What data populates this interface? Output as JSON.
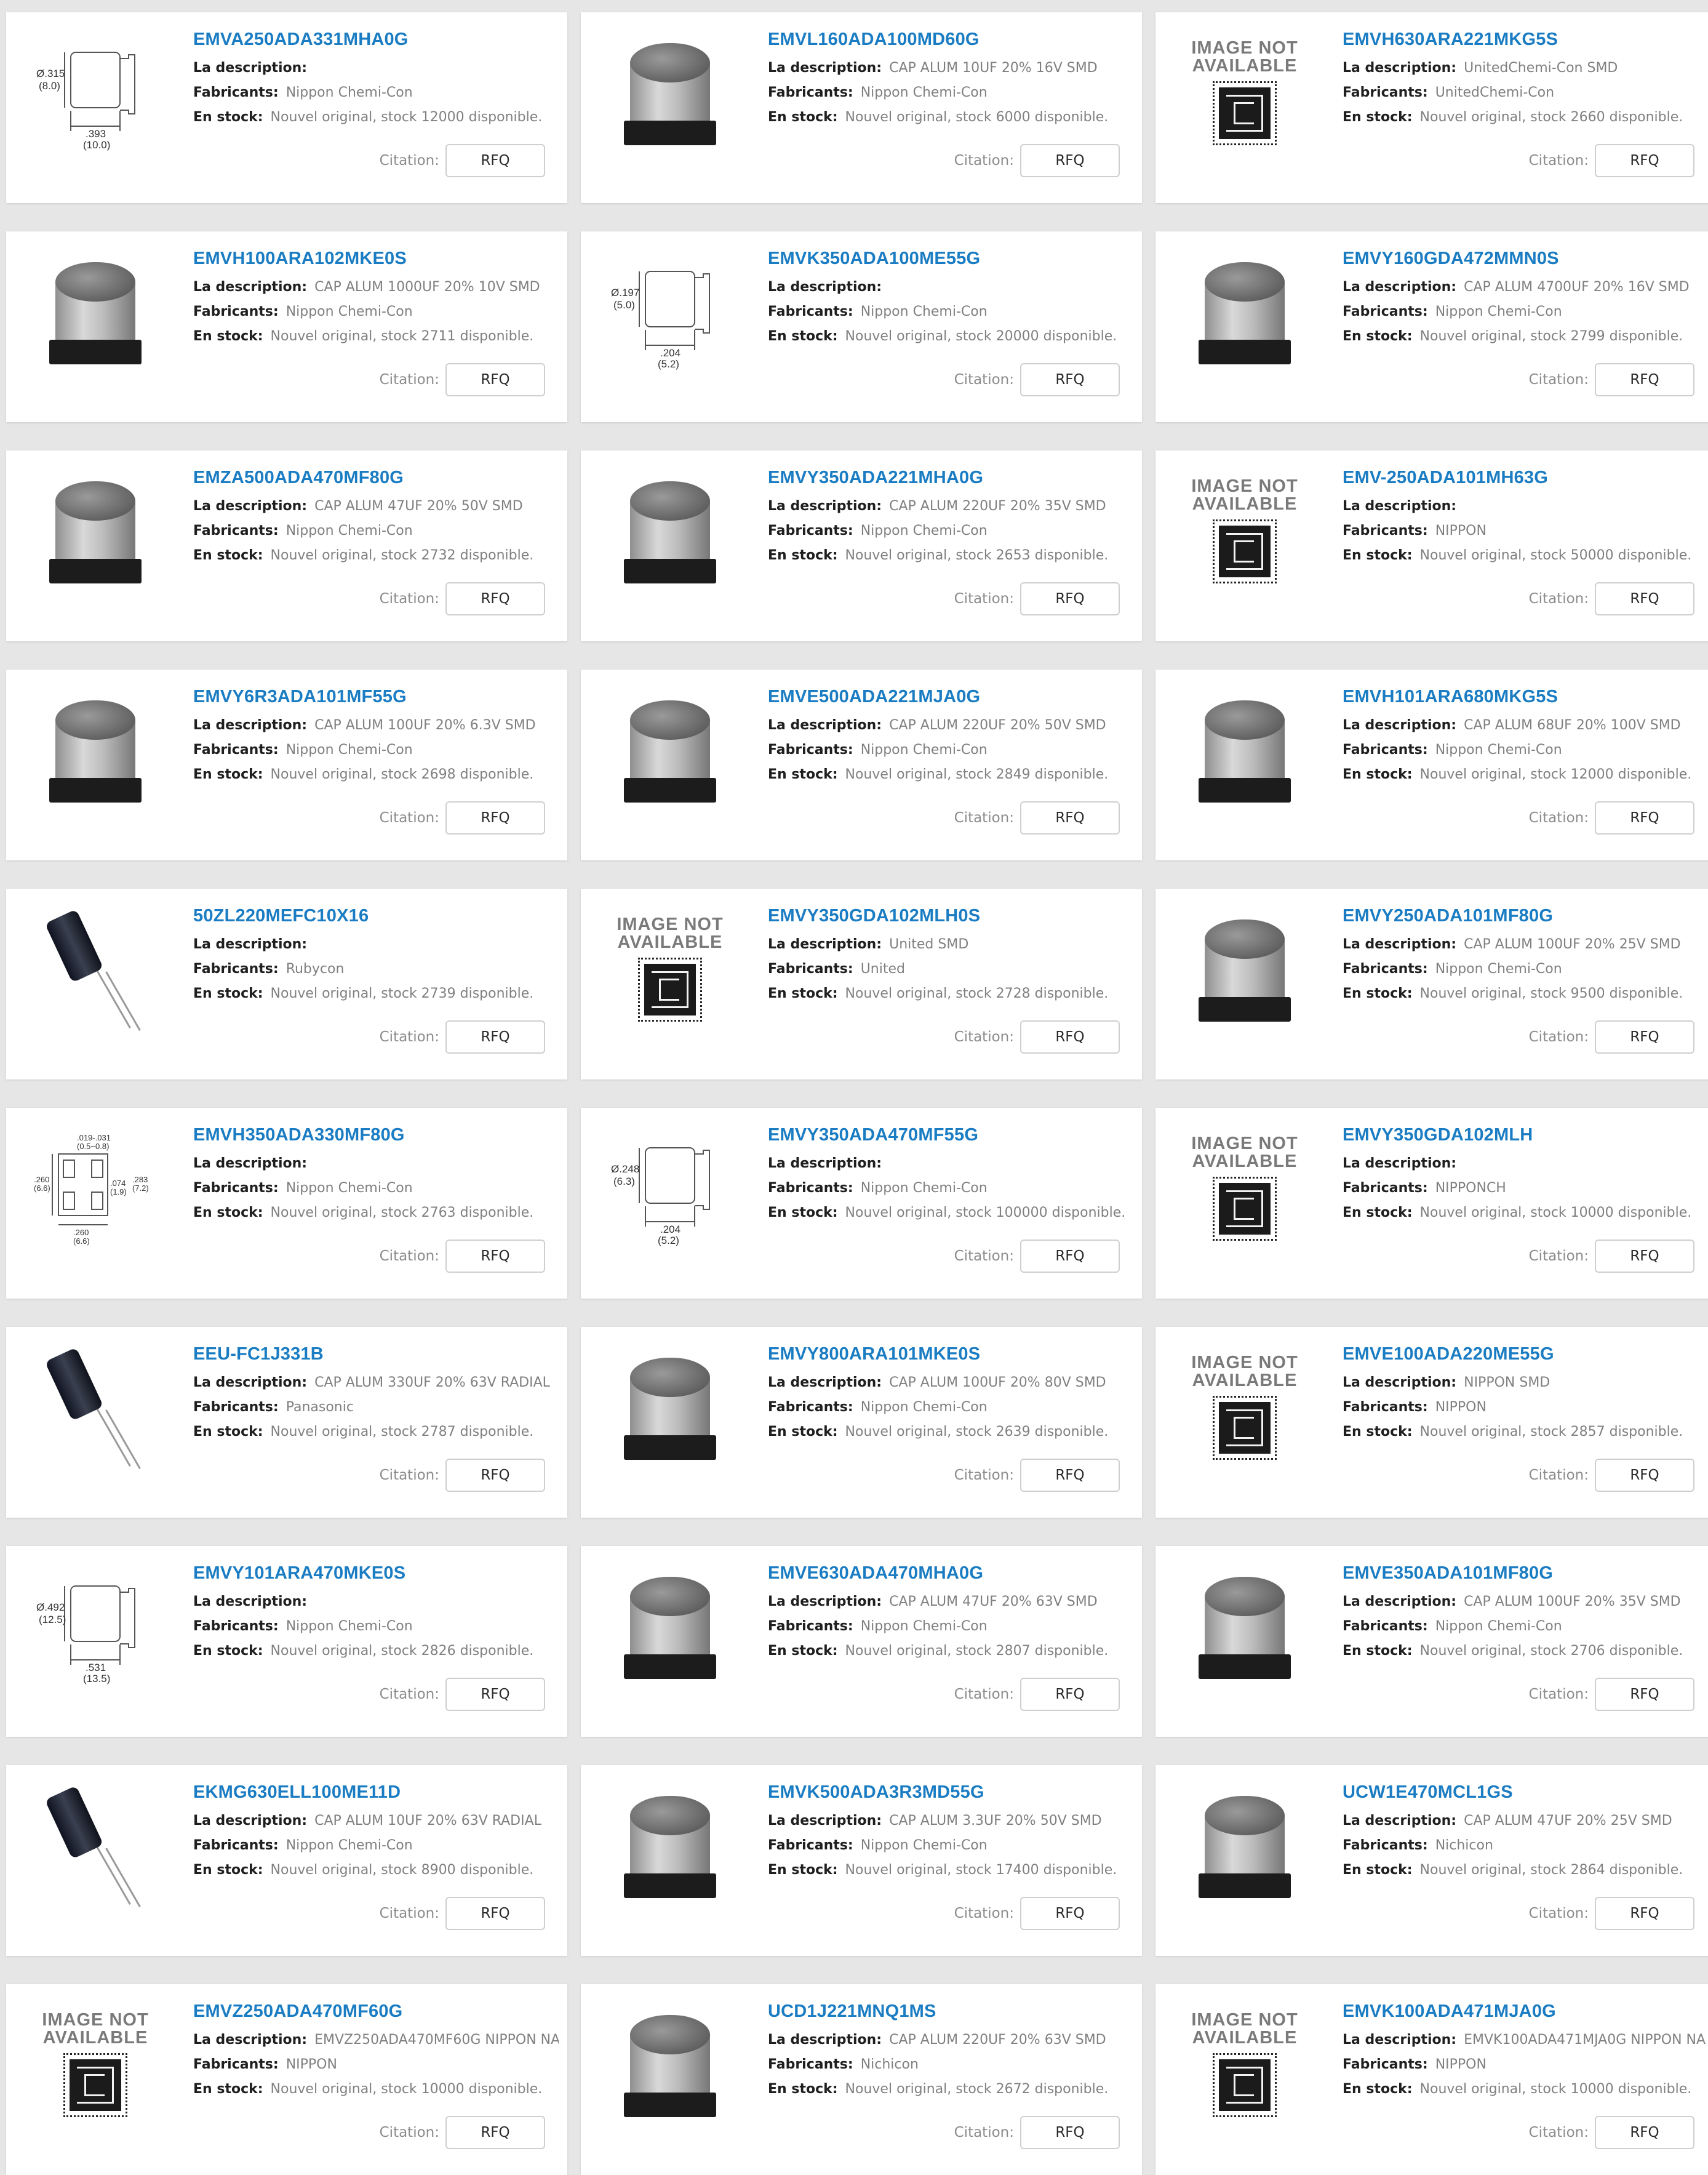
{
  "labels": {
    "description": "La description:",
    "manufacturer": "Fabricants:",
    "stock": "En stock:",
    "quote": "Citation:",
    "rfq": "RFQ",
    "image_not_available": [
      "IMAGE NOT",
      "AVAILABLE"
    ]
  },
  "products": [
    {
      "part": "EMVA250ADA331MHA0G",
      "description": "",
      "manufacturer": "Nippon Chemi-Con",
      "stock": "Nouvel original, stock 12000 disponible.",
      "image": "drawing",
      "dim": [
        "Ø.315",
        "(8.0)",
        ".393",
        "(10.0)"
      ]
    },
    {
      "part": "EMVL160ADA100MD60G",
      "description": "CAP ALUM 10UF 20% 16V SMD",
      "manufacturer": "Nippon Chemi-Con",
      "stock": "Nouvel original, stock 6000 disponible.",
      "image": "smd"
    },
    {
      "part": "EMVH630ARA221MKG5S",
      "description": "UnitedChemi-Con SMD",
      "manufacturer": "UnitedChemi-Con",
      "stock": "Nouvel original, stock 2660 disponible.",
      "image": "na"
    },
    {
      "part": "EMVH100ARA102MKE0S",
      "description": "CAP ALUM 1000UF 20% 10V SMD",
      "manufacturer": "Nippon Chemi-Con",
      "stock": "Nouvel original, stock 2711 disponible.",
      "image": "smd"
    },
    {
      "part": "EMVK350ADA100ME55G",
      "description": "",
      "manufacturer": "Nippon Chemi-Con",
      "stock": "Nouvel original, stock 20000 disponible.",
      "image": "drawing",
      "dim": [
        "Ø.197",
        "(5.0)",
        ".204",
        "(5.2)"
      ]
    },
    {
      "part": "EMVY160GDA472MMN0S",
      "description": "CAP ALUM 4700UF 20% 16V SMD",
      "manufacturer": "Nippon Chemi-Con",
      "stock": "Nouvel original, stock 2799 disponible.",
      "image": "smd"
    },
    {
      "part": "EMZA500ADA470MF80G",
      "description": "CAP ALUM 47UF 20% 50V SMD",
      "manufacturer": "Nippon Chemi-Con",
      "stock": "Nouvel original, stock 2732 disponible.",
      "image": "smd"
    },
    {
      "part": "EMVY350ADA221MHA0G",
      "description": "CAP ALUM 220UF 20% 35V SMD",
      "manufacturer": "Nippon Chemi-Con",
      "stock": "Nouvel original, stock 2653 disponible.",
      "image": "smd"
    },
    {
      "part": "EMV-250ADA101MH63G",
      "description": "",
      "manufacturer": "NIPPON",
      "stock": "Nouvel original, stock 50000 disponible.",
      "image": "na"
    },
    {
      "part": "EMVY6R3ADA101MF55G",
      "description": "CAP ALUM 100UF 20% 6.3V SMD",
      "manufacturer": "Nippon Chemi-Con",
      "stock": "Nouvel original, stock 2698 disponible.",
      "image": "smd"
    },
    {
      "part": "EMVE500ADA221MJA0G",
      "description": "CAP ALUM 220UF 20% 50V SMD",
      "manufacturer": "Nippon Chemi-Con",
      "stock": "Nouvel original, stock 2849 disponible.",
      "image": "smd"
    },
    {
      "part": "EMVH101ARA680MKG5S",
      "description": "CAP ALUM 68UF 20% 100V SMD",
      "manufacturer": "Nippon Chemi-Con",
      "stock": "Nouvel original, stock 12000 disponible.",
      "image": "smd"
    },
    {
      "part": "50ZL220MEFC10X16",
      "description": "",
      "manufacturer": "Rubycon",
      "stock": "Nouvel original, stock 2739 disponible.",
      "image": "radial"
    },
    {
      "part": "EMVY350GDA102MLH0S",
      "description": "United SMD",
      "manufacturer": "United",
      "stock": "Nouvel original, stock 2728 disponible.",
      "image": "na"
    },
    {
      "part": "EMVY250ADA101MF80G",
      "description": "CAP ALUM 100UF 20% 25V SMD",
      "manufacturer": "Nippon Chemi-Con",
      "stock": "Nouvel original, stock 9500 disponible.",
      "image": "smd"
    },
    {
      "part": "EMVH350ADA330MF80G",
      "description": "",
      "manufacturer": "Nippon Chemi-Con",
      "stock": "Nouvel original, stock 2763 disponible.",
      "image": "footprint"
    },
    {
      "part": "EMVY350ADA470MF55G",
      "description": "",
      "manufacturer": "Nippon Chemi-Con",
      "stock": "Nouvel original, stock 100000 disponible.",
      "image": "drawing",
      "dim": [
        "Ø.248",
        "(6.3)",
        ".204",
        "(5.2)"
      ]
    },
    {
      "part": "EMVY350GDA102MLH",
      "description": "",
      "manufacturer": "NIPPONCH",
      "stock": "Nouvel original, stock 10000 disponible.",
      "image": "na"
    },
    {
      "part": "EEU-FC1J331B",
      "description": "CAP ALUM 330UF 20% 63V RADIAL",
      "manufacturer": "Panasonic",
      "stock": "Nouvel original, stock 2787 disponible.",
      "image": "radial"
    },
    {
      "part": "EMVY800ARA101MKE0S",
      "description": "CAP ALUM 100UF 20% 80V SMD",
      "manufacturer": "Nippon Chemi-Con",
      "stock": "Nouvel original, stock 2639 disponible.",
      "image": "smd"
    },
    {
      "part": "EMVE100ADA220ME55G",
      "description": "NIPPON SMD",
      "manufacturer": "NIPPON",
      "stock": "Nouvel original, stock 2857 disponible.",
      "image": "na"
    },
    {
      "part": "EMVY101ARA470MKE0S",
      "description": "",
      "manufacturer": "Nippon Chemi-Con",
      "stock": "Nouvel original, stock 2826 disponible.",
      "image": "drawing",
      "dim": [
        "Ø.492",
        "(12.5)",
        ".531",
        "(13.5)"
      ]
    },
    {
      "part": "EMVE630ADA470MHA0G",
      "description": "CAP ALUM 47UF 20% 63V SMD",
      "manufacturer": "Nippon Chemi-Con",
      "stock": "Nouvel original, stock 2807 disponible.",
      "image": "smd"
    },
    {
      "part": "EMVE350ADA101MF80G",
      "description": "CAP ALUM 100UF 20% 35V SMD",
      "manufacturer": "Nippon Chemi-Con",
      "stock": "Nouvel original, stock 2706 disponible.",
      "image": "smd"
    },
    {
      "part": "EKMG630ELL100ME11D",
      "description": "CAP ALUM 10UF 20% 63V RADIAL",
      "manufacturer": "Nippon Chemi-Con",
      "stock": "Nouvel original, stock 8900 disponible.",
      "image": "radial"
    },
    {
      "part": "EMVK500ADA3R3MD55G",
      "description": "CAP ALUM 3.3UF 20% 50V SMD",
      "manufacturer": "Nippon Chemi-Con",
      "stock": "Nouvel original, stock 17400 disponible.",
      "image": "smd"
    },
    {
      "part": "UCW1E470MCL1GS",
      "description": "CAP ALUM 47UF 20% 25V SMD",
      "manufacturer": "Nichicon",
      "stock": "Nouvel original, stock 2864 disponible.",
      "image": "smd"
    },
    {
      "part": "EMVZ250ADA470MF60G",
      "description": "EMVZ250ADA470MF60G NIPPON NA",
      "manufacturer": "NIPPON",
      "stock": "Nouvel original, stock 10000 disponible.",
      "image": "na"
    },
    {
      "part": "UCD1J221MNQ1MS",
      "description": "CAP ALUM 220UF 20% 63V SMD",
      "manufacturer": "Nichicon",
      "stock": "Nouvel original, stock 2672 disponible.",
      "image": "smd"
    },
    {
      "part": "EMVK100ADA471MJA0G",
      "description": "EMVK100ADA471MJA0G NIPPON NA",
      "manufacturer": "NIPPON",
      "stock": "Nouvel original, stock 10000 disponible.",
      "image": "na"
    }
  ],
  "footprint_dims": [
    ".019-.031",
    "(0.5~0.8)",
    ".260",
    "(6.6)",
    ".074",
    "(1.9)",
    ".283",
    "(7.2)",
    ".260",
    "(6.6)"
  ]
}
